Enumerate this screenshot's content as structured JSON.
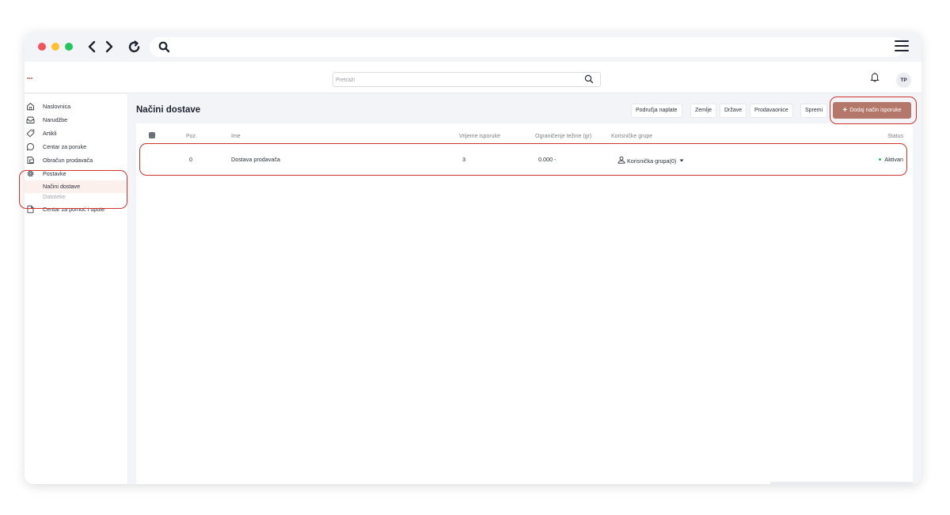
{
  "browser": {
    "back_icon": "chevron-left-icon",
    "forward_icon": "chevron-right-icon",
    "reload_icon": "reload-icon",
    "search_icon": "search-icon",
    "menu_icon": "hamburger-icon"
  },
  "topbar": {
    "search_placeholder": "Pretraži",
    "avatar_initials": "TP"
  },
  "sidebar": {
    "items": [
      {
        "label": "Naslovnica",
        "icon": "home-icon"
      },
      {
        "label": "Narudžbe",
        "icon": "inbox-icon"
      },
      {
        "label": "Artikli",
        "icon": "tag-icon"
      },
      {
        "label": "Centar za poruke",
        "icon": "chat-icon"
      },
      {
        "label": "Obračun prodavača",
        "icon": "document-icon"
      },
      {
        "label": "Postavke",
        "icon": "gear-icon"
      }
    ],
    "sub_items": [
      {
        "label": "Načini dostave",
        "active": true
      },
      {
        "label": "Datoteke",
        "active": false
      }
    ],
    "help_item": {
      "label": "Centar za pomoć i upute",
      "icon": "file-icon"
    }
  },
  "page": {
    "title": "Načini dostave",
    "toolbar": {
      "buttons": [
        "Područja naplate",
        "Zemlje",
        "Države",
        "Prodavaonice",
        "Spremi"
      ],
      "primary_label": "Dodaj način isporuke"
    }
  },
  "table": {
    "columns": [
      "Poz.",
      "Ime",
      "Vrijeme isporuke",
      "Ograničenje težine (gr)",
      "Korisničke grupe",
      "Status"
    ],
    "rows": [
      {
        "pos": "0",
        "name": "Dostava prodavača",
        "delivery_time": "3",
        "weight_limit": "0.000 -",
        "user_groups": "Korisnička grupa(0)",
        "status": "Aktivan"
      }
    ]
  },
  "colors": {
    "accent": "#b3786a",
    "highlight": "#d2342d",
    "status_active": "#23c55e"
  }
}
